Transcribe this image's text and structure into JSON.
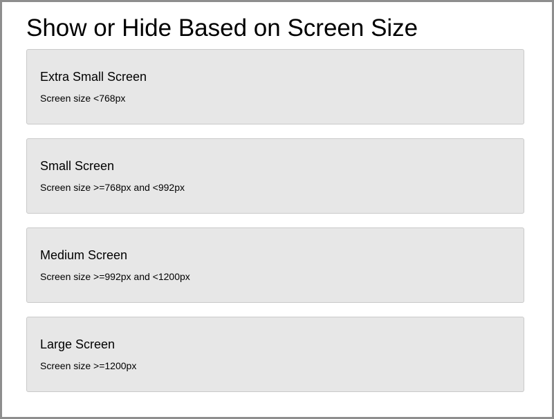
{
  "page": {
    "title": "Show or Hide Based on Screen Size"
  },
  "cards": [
    {
      "title": "Extra Small Screen",
      "text": "Screen size <768px"
    },
    {
      "title": "Small Screen",
      "text": "Screen size >=768px and <992px"
    },
    {
      "title": "Medium Screen",
      "text": "Screen size >=992px and <1200px"
    },
    {
      "title": "Large Screen",
      "text": "Screen size >=1200px"
    }
  ],
  "colors": {
    "frame_border": "#8e8e8e",
    "card_background": "#e7e7e7",
    "card_border": "#c9c9c9",
    "text": "#000000"
  }
}
